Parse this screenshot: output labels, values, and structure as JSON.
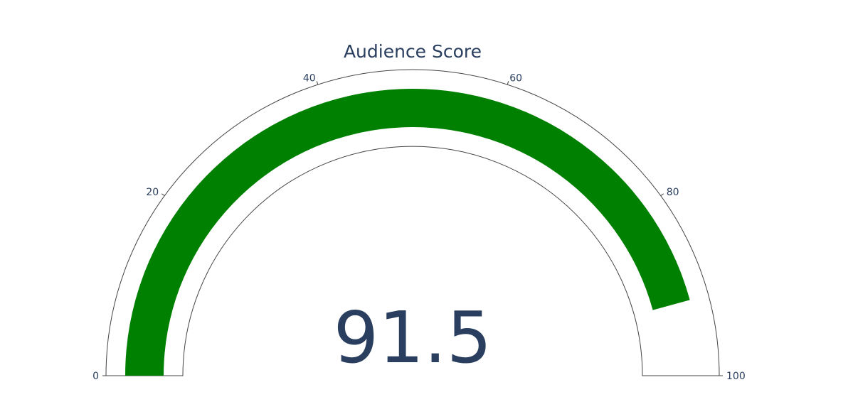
{
  "chart_data": {
    "type": "gauge",
    "title": "Audience Score",
    "value": 91.5,
    "value_label": "91.5",
    "range": [
      0,
      100
    ],
    "ticks": [
      0,
      20,
      40,
      60,
      80,
      100
    ],
    "tick_labels": [
      "0",
      "20",
      "40",
      "60",
      "80",
      "100"
    ],
    "bar_color": "#008000",
    "outline_color": "#444444",
    "text_color": "#2a3f5f",
    "background": "#ffffff"
  }
}
